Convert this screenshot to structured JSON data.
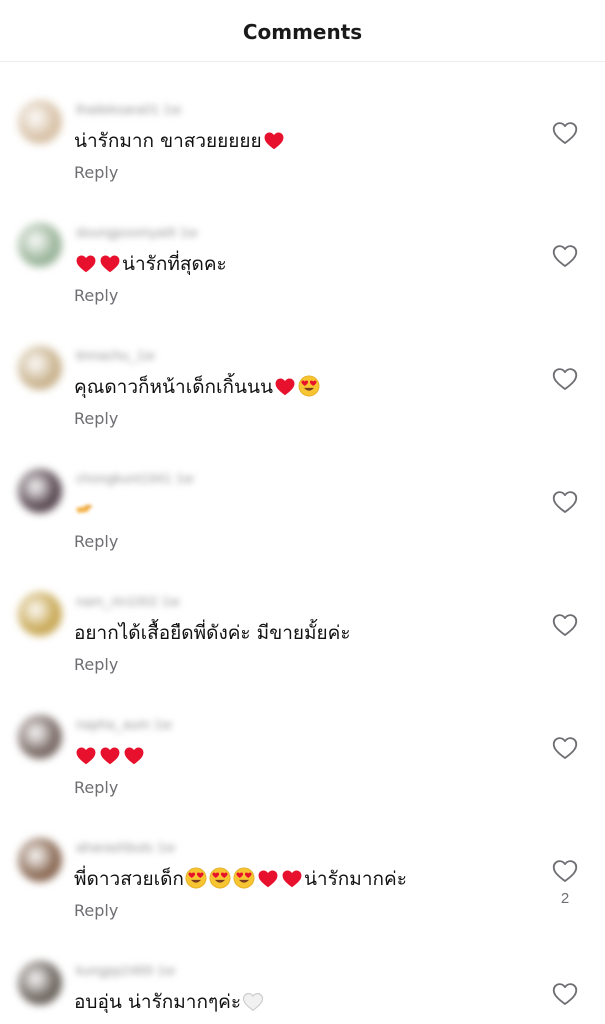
{
  "header": {
    "title": "Comments"
  },
  "colors": {
    "heart_red": "#e8112d",
    "text_primary": "#111111",
    "text_secondary": "#6e6e73",
    "divider": "#ececec"
  },
  "comments": [
    {
      "username": "thaileksara01 1w",
      "text": "น่ารักมาก ขาสวยยยยย",
      "trailing_emoji": [
        "red-heart"
      ],
      "reply_label": "Reply",
      "like_count": "",
      "avatar_color": "#d8c2a8"
    },
    {
      "username": "doungpoomyai9 1w",
      "leading_emoji": [
        "red-heart",
        "red-heart"
      ],
      "text": "น่ารักที่สุดคะ",
      "reply_label": "Reply",
      "like_count": "",
      "avatar_color": "#9bb59a"
    },
    {
      "username": "tinnachu_1w",
      "text": "คุณดาวก็หน้าเด็กเกิ้นนน",
      "trailing_emoji": [
        "red-heart",
        "heart-eyes"
      ],
      "reply_label": "Reply",
      "like_count": "",
      "avatar_color": "#c9b38e"
    },
    {
      "username": "chongkunt1941 1w",
      "text": "",
      "trailing_emoji": [
        "pointing-hand"
      ],
      "reply_label": "Reply",
      "like_count": "",
      "avatar_color": "#5a4a52"
    },
    {
      "username": "nam_rin1002 1w",
      "text": "อยากได้เสื้อยืดพี่ดังค่ะ มีขายมั้ยค่ะ",
      "reply_label": "Reply",
      "like_count": "",
      "avatar_color": "#c9a957"
    },
    {
      "username": "napha_aum 1w",
      "leading_emoji": [
        "red-heart",
        "red-heart",
        "red-heart"
      ],
      "text": "",
      "reply_label": "Reply",
      "like_count": "",
      "avatar_color": "#7a6b66"
    },
    {
      "username": "aharashbuts 1w",
      "text": "พี่ดาวสวยเด็ก",
      "trailing_emoji": [
        "heart-eyes",
        "heart-eyes",
        "heart-eyes",
        "red-heart",
        "red-heart"
      ],
      "trailing_text": "น่ารักมากค่ะ",
      "reply_label": "Reply",
      "like_count": "2",
      "avatar_color": "#8b6a55"
    },
    {
      "username": "kungpp2469 1w",
      "text": "อบอุ่น น่ารักมากๆค่ะ",
      "trailing_emoji": [
        "white-heart"
      ],
      "reply_label": "",
      "like_count": "",
      "avatar_color": "#6e6660"
    }
  ]
}
